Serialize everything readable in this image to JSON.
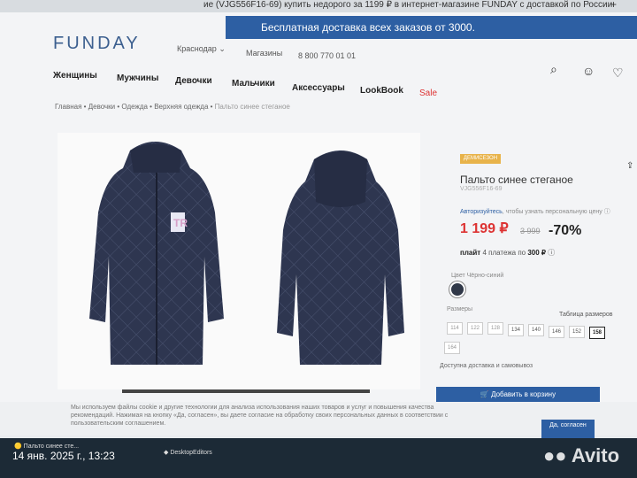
{
  "browser": {
    "tab_title": "ие (VJG556F16-69) купить недорого за 1199 ₽ в интернет-магазине FUNDAY с доставкой по России",
    "new_tab": "+"
  },
  "header": {
    "banner": "Бесплатная доставка всех заказов от 3000.",
    "logo": "FUNDAY",
    "city": "Краснодар",
    "stores": "Магазины",
    "phone": "8 800 770 01 01"
  },
  "nav": {
    "items": [
      "Женщины",
      "Мужчины",
      "Девочки",
      "Мальчики",
      "Аксессуары",
      "LookBook",
      "Sale"
    ]
  },
  "icons": {
    "search": "search-icon",
    "profile": "user-icon",
    "wishlist": "heart-icon",
    "share": "share-icon",
    "help": "help-icon"
  },
  "breadcrumb": {
    "items": [
      "Главная",
      "Девочки",
      "Одежда",
      "Верхняя одежда"
    ],
    "current": "Пальто синее стеганое"
  },
  "product": {
    "badge": "ДЕМИСЕЗОН",
    "title": "Пальто синее стеганое",
    "sku": "VJG556F16-69",
    "login_link": "Авторизуйтесь",
    "login_note": ", чтобы узнать персональную цену",
    "price": "1 199 ₽",
    "old_price": "3 999",
    "discount": "-70%",
    "plait_brand": "плайт",
    "plait_text": "4 платежа по",
    "plait_amount": "300 ₽",
    "color_label": "Цвет",
    "color_value": "Чёрно-синий",
    "color_hex": "#303848",
    "sizes_label": "Размеры",
    "size_table": "Таблица размеров",
    "sizes": [
      "114",
      "122",
      "128",
      "134",
      "140",
      "146",
      "152",
      "158",
      "164"
    ],
    "selected_size": "158",
    "delivery": "Доступна доставка и самовывоз",
    "cart_button": "Добавить в корзину"
  },
  "cookie": {
    "text": "Мы используем файлы cookie и другие технологии для анализа использования наших товаров и услуг и повышения качества рекомендаций. Нажимая на кнопку «Да, согласен», вы даете согласие на обработку своих персональных данных в соответствии с пользовательским соглашением.",
    "button": "Да, согласен"
  },
  "taskbar": {
    "app1": "Пальто синее сте...",
    "app2": "DesktopEditors",
    "datetime": "14 янв. 2025 г., 13:23"
  },
  "watermark": "Avito"
}
